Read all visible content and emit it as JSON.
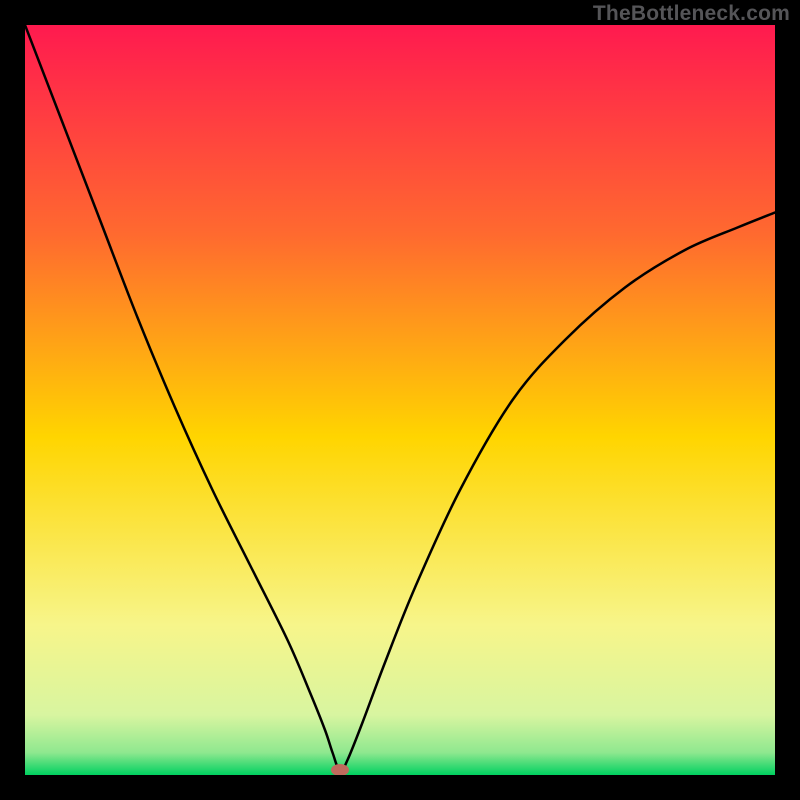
{
  "watermark": "TheBottleneck.com",
  "chart_data": {
    "type": "line",
    "title": "",
    "xlabel": "",
    "ylabel": "",
    "xlim": [
      0,
      100
    ],
    "ylim": [
      0,
      100
    ],
    "background_gradient": {
      "top": "#ff1a4f",
      "upper_mid": "#ff8a2a",
      "mid": "#ffd500",
      "lower_mid": "#f7f58a",
      "bottom_band": "#8fe88f",
      "bottom": "#00d060"
    },
    "series": [
      {
        "name": "bottleneck-curve",
        "x": [
          0,
          5,
          10,
          15,
          20,
          25,
          30,
          35,
          38,
          40,
          41,
          42,
          43,
          45,
          48,
          52,
          58,
          65,
          72,
          80,
          88,
          95,
          100
        ],
        "y": [
          100,
          87,
          74,
          61,
          49,
          38,
          28,
          18,
          11,
          6,
          3,
          0.5,
          2,
          7,
          15,
          25,
          38,
          50,
          58,
          65,
          70,
          73,
          75
        ]
      }
    ],
    "marker": {
      "name": "minimum-marker",
      "x": 42,
      "y": 0,
      "color": "#c06a5d"
    }
  }
}
